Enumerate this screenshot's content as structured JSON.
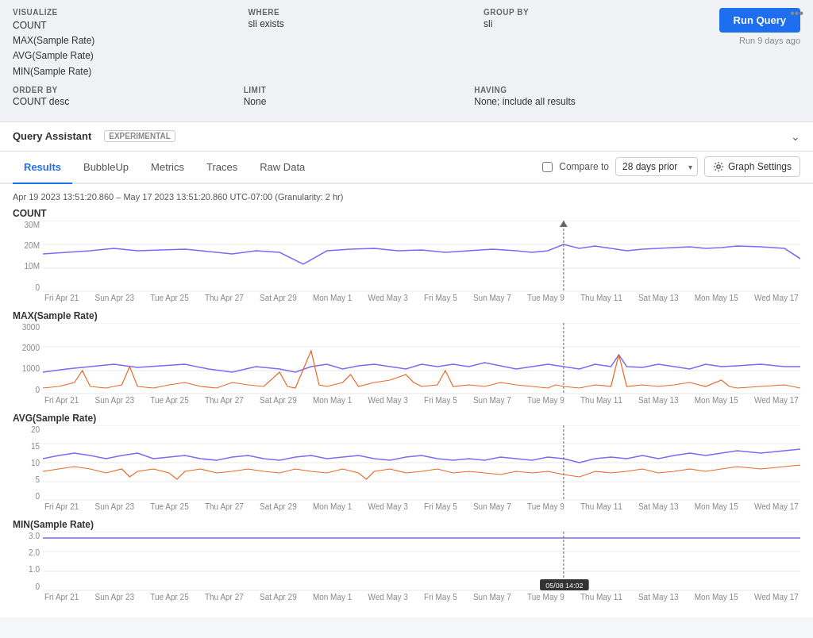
{
  "menu_dots": "•••",
  "query_panel": {
    "visualize_label": "VISUALIZE",
    "visualize_values": [
      "COUNT",
      "MAX(Sample Rate)",
      "AVG(Sample Rate)",
      "MIN(Sample Rate)"
    ],
    "where_label": "WHERE",
    "where_value": "sli exists",
    "group_by_label": "GROUP BY",
    "group_by_value": "sli",
    "run_button_label": "Run Query",
    "run_ago": "Run 9 days ago",
    "order_by_label": "ORDER BY",
    "order_by_value": "COUNT desc",
    "limit_label": "LIMIT",
    "limit_value": "None",
    "having_label": "HAVING",
    "having_value": "None; include all results"
  },
  "query_assistant": {
    "label": "Query Assistant",
    "badge": "EXPERIMENTAL"
  },
  "tabs": [
    "Results",
    "BubbleUp",
    "Metrics",
    "Traces",
    "Raw Data"
  ],
  "active_tab": "Results",
  "compare_to_label": "Compare to",
  "compare_option": "28 days prior",
  "graph_settings_label": "Graph Settings",
  "time_range": "Apr 19 2023 13:51:20.860 – May 17 2023 13:51:20.860 UTC-07:00 (Granularity: 2 hr)",
  "crosshair_date": "05/08 14:02",
  "charts": [
    {
      "id": "count",
      "title": "COUNT",
      "y_labels": [
        "30M",
        "20M",
        "10M",
        "0"
      ],
      "x_labels": [
        "Fri Apr 21",
        "Sun Apr 23",
        "Tue Apr 25",
        "Thu Apr 27",
        "Sat Apr 29",
        "Mon May 1",
        "Wed May 3",
        "Fri May 5",
        "Sun May 7",
        "Tue May 9",
        "Thu May 11",
        "Sat May 13",
        "Mon May 15",
        "Wed May 17"
      ],
      "height": 90
    },
    {
      "id": "max",
      "title": "MAX(Sample Rate)",
      "y_labels": [
        "3000",
        "2000",
        "1000",
        "0"
      ],
      "x_labels": [
        "Fri Apr 21",
        "Sun Apr 23",
        "Tue Apr 25",
        "Thu Apr 27",
        "Sat Apr 29",
        "Mon May 1",
        "Wed May 3",
        "Fri May 5",
        "Sun May 7",
        "Tue May 9",
        "Thu May 11",
        "Sat May 13",
        "Mon May 15",
        "Wed May 17"
      ],
      "height": 90
    },
    {
      "id": "avg",
      "title": "AVG(Sample Rate)",
      "y_labels": [
        "20",
        "15",
        "10",
        "5",
        "0"
      ],
      "x_labels": [
        "Fri Apr 21",
        "Sun Apr 23",
        "Tue Apr 25",
        "Thu Apr 27",
        "Sat Apr 29",
        "Mon May 1",
        "Wed May 3",
        "Fri May 5",
        "Sun May 7",
        "Tue May 9",
        "Thu May 11",
        "Sat May 13",
        "Mon May 15",
        "Wed May 17"
      ],
      "height": 90
    },
    {
      "id": "min",
      "title": "MIN(Sample Rate)",
      "y_labels": [
        "3.0",
        "2.0",
        "1.0",
        "0"
      ],
      "x_labels": [
        "Fri Apr 21",
        "Sun Apr 23",
        "Tue Apr 25",
        "Thu Apr 27",
        "Sat Apr 29",
        "Mon May 1",
        "Wed May 3",
        "Fri May 5",
        "Sun May 7",
        "Tue May 9",
        "Thu May 11",
        "Sat May 13",
        "Mon May 15",
        "Wed May 17"
      ],
      "height": 70
    }
  ]
}
